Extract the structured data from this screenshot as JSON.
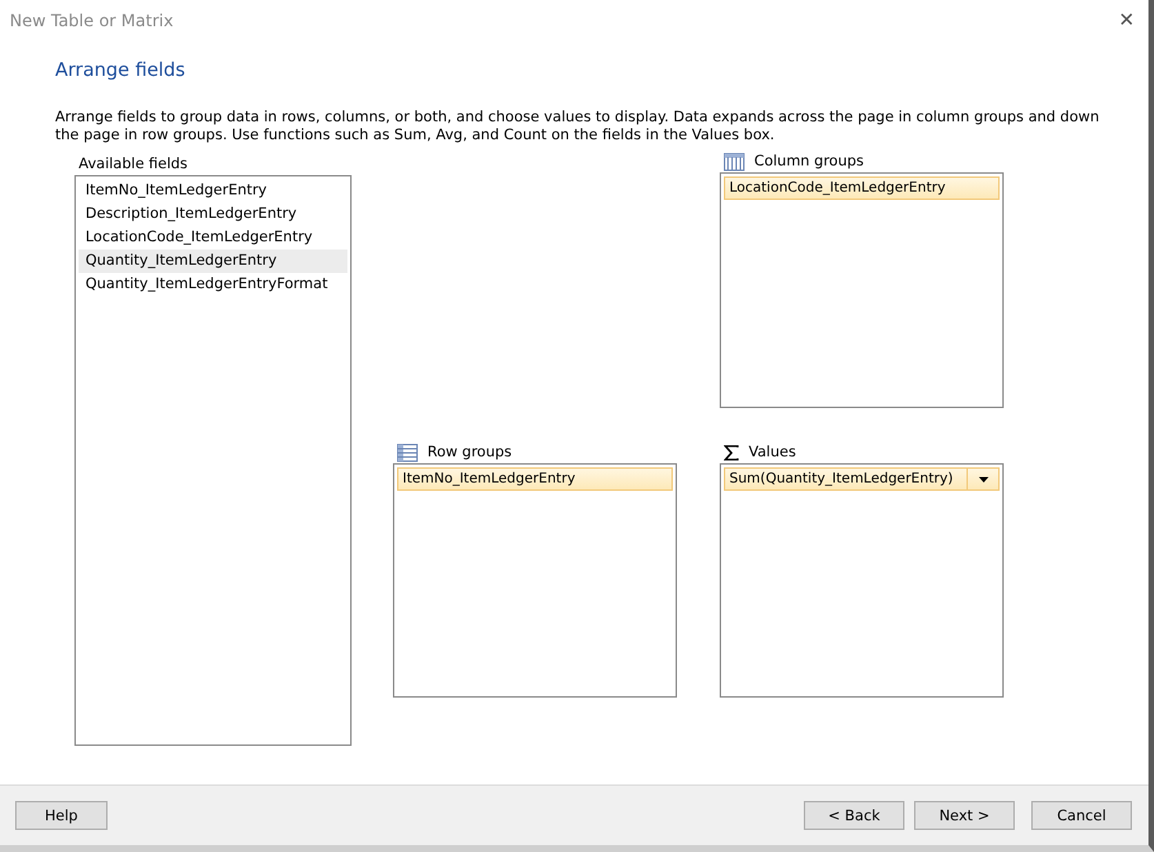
{
  "window": {
    "title": "New Table or Matrix",
    "close": "✕"
  },
  "heading": "Arrange fields",
  "description": "Arrange fields to group data in rows, columns, or both, and choose values to display. Data expands across the page in column groups and down the page in row groups.  Use functions such as Sum, Avg, and Count on the fields in the Values box.",
  "available_fields": {
    "label": "Available fields",
    "items": [
      {
        "text": "ItemNo_ItemLedgerEntry",
        "selected": false
      },
      {
        "text": "Description_ItemLedgerEntry",
        "selected": false
      },
      {
        "text": "LocationCode_ItemLedgerEntry",
        "selected": false
      },
      {
        "text": "Quantity_ItemLedgerEntry",
        "selected": true
      },
      {
        "text": "Quantity_ItemLedgerEntryFormat",
        "selected": false
      }
    ]
  },
  "column_groups": {
    "label": "Column groups",
    "items": [
      {
        "text": "LocationCode_ItemLedgerEntry",
        "dropdown": false
      }
    ]
  },
  "row_groups": {
    "label": "Row groups",
    "items": [
      {
        "text": "ItemNo_ItemLedgerEntry",
        "dropdown": false
      }
    ]
  },
  "values": {
    "label": "Values",
    "items": [
      {
        "text": "Sum(Quantity_ItemLedgerEntry)",
        "dropdown": true
      }
    ]
  },
  "buttons": {
    "help": "Help",
    "back": "< Back",
    "next": "Next >",
    "cancel": "Cancel"
  }
}
